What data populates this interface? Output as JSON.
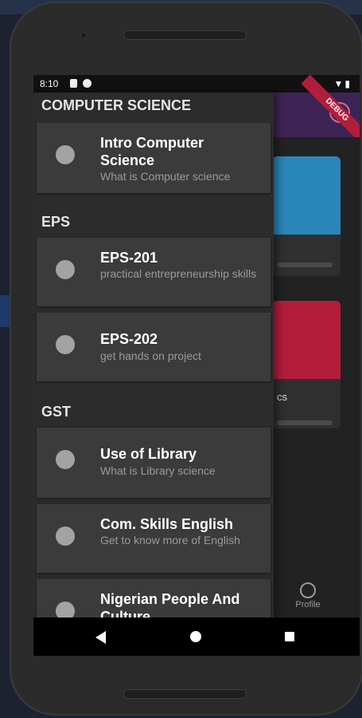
{
  "status_bar": {
    "time": "8:10"
  },
  "debug_banner": "DEBUG",
  "sections": [
    {
      "header": "COMPUTER SCIENCE",
      "items": [
        {
          "title": "Intro Computer Science",
          "subtitle": "What is Computer science"
        }
      ]
    },
    {
      "header": "EPS",
      "items": [
        {
          "title": "EPS-201",
          "subtitle": "practical entrepreneurship skills"
        },
        {
          "title": "EPS-202",
          "subtitle": "get hands on project"
        }
      ]
    },
    {
      "header": "GST",
      "items": [
        {
          "title": "Use of Library",
          "subtitle": "What is Library science"
        },
        {
          "title": "Com. Skills English",
          "subtitle": "Get to know more of English"
        },
        {
          "title": "Nigerian People And Culture",
          "subtitle": ""
        }
      ]
    }
  ],
  "background_app": {
    "card_partial_text": "cs",
    "bottom_nav_profile_label": "Profile",
    "card_colors": [
      "#2a86b8",
      "#b31d3a"
    ]
  },
  "colors": {
    "header_purple": "#3e2455",
    "drawer_bg": "#2c2c2c",
    "item_bg": "#3b3b3b"
  }
}
